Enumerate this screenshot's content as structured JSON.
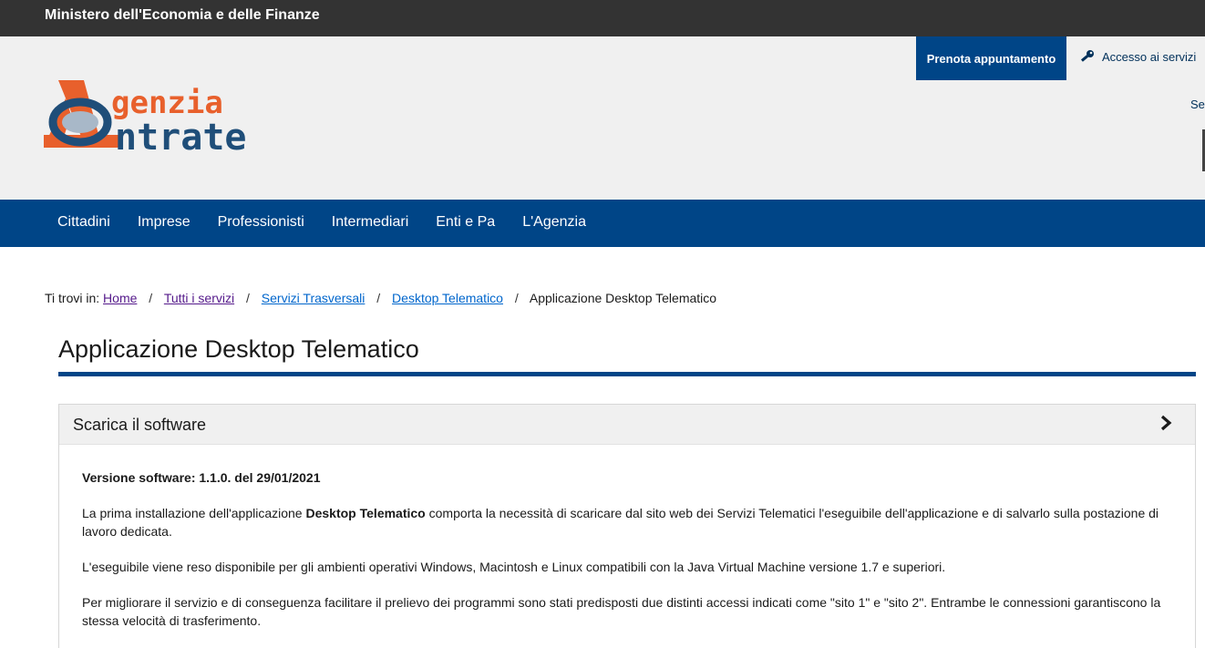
{
  "topbar": {
    "ministry": "Ministero dell'Economia e delle Finanze"
  },
  "header": {
    "logo_line1": "genzia",
    "logo_line2": "ntrate",
    "prenota_label": "Prenota appuntamento",
    "accesso_label": "Accesso ai servizi",
    "seg_label": "Seg",
    "colors": {
      "brand_orange": "#e8602c",
      "brand_blue": "#1f4e79",
      "nav_blue": "#004587"
    }
  },
  "nav": {
    "items": [
      {
        "label": "Cittadini"
      },
      {
        "label": "Imprese"
      },
      {
        "label": "Professionisti"
      },
      {
        "label": "Intermediari"
      },
      {
        "label": "Enti e Pa"
      },
      {
        "label": "L'Agenzia"
      }
    ]
  },
  "breadcrumb": {
    "prefix": "Ti trovi in:",
    "separator": "/",
    "links": [
      {
        "label": "Home"
      },
      {
        "label": "Tutti i servizi"
      },
      {
        "label": "Servizi Trasversali"
      },
      {
        "label": "Desktop Telematico"
      }
    ],
    "current": "Applicazione Desktop Telematico"
  },
  "page": {
    "title": "Applicazione Desktop Telematico"
  },
  "accordion": {
    "title": "Scarica il software",
    "icon": "chevron-right-icon",
    "version": "Versione software: 1.1.0. del 29/01/2021",
    "p1_before": "La prima installazione dell'applicazione ",
    "p1_bold": "Desktop Telematico",
    "p1_after": " comporta la necessità di scaricare dal sito web dei Servizi Telematici l'eseguibile dell'applicazione e di salvarlo sulla postazione di lavoro dedicata.",
    "p2": "L'eseguibile viene reso disponibile per gli ambienti operativi Windows, Macintosh e Linux compatibili con la Java Virtual Machine versione 1.7 e superiori.",
    "p3": "Per migliorare il servizio e di conseguenza facilitare il prelievo dei programmi sono stati predisposti due distinti accessi indicati come \"sito 1\" e \"sito 2\". Entrambe le connessioni garantiscono la stessa velocità di trasferimento."
  }
}
